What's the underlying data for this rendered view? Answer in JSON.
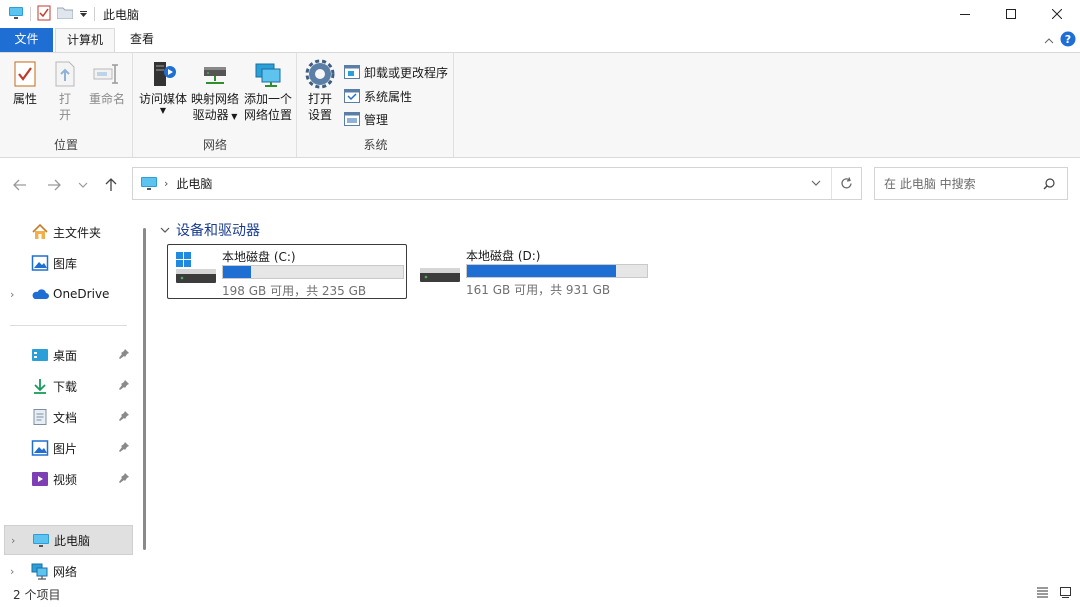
{
  "titlebar": {
    "title": "此电脑",
    "window_controls": [
      "minimize-icon",
      "maximize-icon",
      "close-icon"
    ]
  },
  "tabs": {
    "file": "文件",
    "computer": "计算机",
    "view": "查看"
  },
  "ribbon": {
    "location": {
      "label": "位置",
      "properties": "属性",
      "open_line1": "打",
      "open_line2": "开",
      "rename": "重命名"
    },
    "network": {
      "label": "网络",
      "access_media": "访问媒体",
      "map_drive_line1": "映射网络",
      "map_drive_line2": "驱动器",
      "add_location_line1": "添加一个",
      "add_location_line2": "网络位置"
    },
    "system": {
      "label": "系统",
      "open_settings_line1": "打开",
      "open_settings_line2": "设置",
      "uninstall": "卸载或更改程序",
      "system_properties": "系统属性",
      "manage": "管理"
    }
  },
  "address": {
    "path": "此电脑",
    "search_placeholder": "在 此电脑 中搜索"
  },
  "nav": {
    "quick": [
      {
        "label": "主文件夹",
        "icon": "home-icon"
      },
      {
        "label": "图库",
        "icon": "gallery-icon"
      },
      {
        "label": "OneDrive",
        "icon": "cloud-icon"
      }
    ],
    "pinned": [
      {
        "label": "桌面",
        "icon": "desktop-icon"
      },
      {
        "label": "下载",
        "icon": "download-icon"
      },
      {
        "label": "文档",
        "icon": "document-icon"
      },
      {
        "label": "图片",
        "icon": "pictures-icon"
      },
      {
        "label": "视频",
        "icon": "videos-icon"
      }
    ],
    "this_pc": "此电脑",
    "network": "网络"
  },
  "content": {
    "group_title": "设备和驱动器",
    "drives": [
      {
        "name": "本地磁盘 (C:)",
        "free_text": "198 GB 可用，共 235 GB",
        "used_fraction": 0.157
      },
      {
        "name": "本地磁盘 (D:)",
        "free_text": "161 GB 可用，共 931 GB",
        "used_fraction": 0.827
      }
    ]
  },
  "status": {
    "count": "2 个项目"
  },
  "colors": {
    "accent": "#1f6ed4",
    "group_title": "#1a3d8f"
  }
}
